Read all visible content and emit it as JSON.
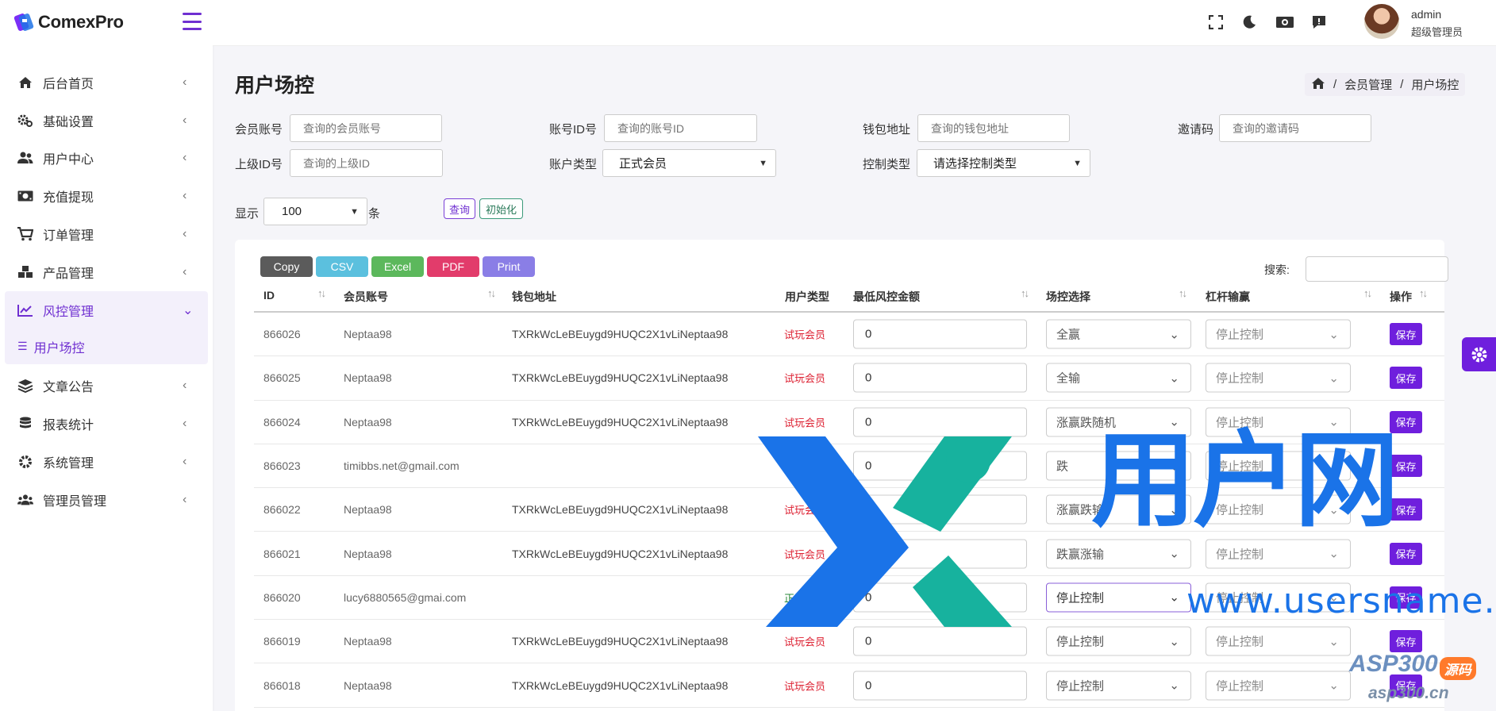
{
  "brand": {
    "name": "ComexPro"
  },
  "sidebar": {
    "items": [
      {
        "label": "后台首页",
        "icon": "home-icon"
      },
      {
        "label": "基础设置",
        "icon": "gears-icon"
      },
      {
        "label": "用户中心",
        "icon": "users-icon"
      },
      {
        "label": "充值提现",
        "icon": "money-icon"
      },
      {
        "label": "订单管理",
        "icon": "cart-icon"
      },
      {
        "label": "产品管理",
        "icon": "cubes-icon"
      },
      {
        "label": "风控管理",
        "icon": "chart-line-icon",
        "active": true
      },
      {
        "label": "文章公告",
        "icon": "layers-icon"
      },
      {
        "label": "报表统计",
        "icon": "database-icon"
      },
      {
        "label": "系统管理",
        "icon": "gear-icon"
      },
      {
        "label": "管理员管理",
        "icon": "user-group-icon"
      }
    ],
    "sub_active": {
      "label": "用户场控"
    }
  },
  "topbar": {
    "user_name": "admin",
    "user_role": "超级管理员"
  },
  "page": {
    "title": "用户场控"
  },
  "breadcrumb": {
    "items": [
      "会员管理",
      "用户场控"
    ]
  },
  "filters": {
    "member_account": {
      "label": "会员账号",
      "placeholder": "查询的会员账号"
    },
    "account_id": {
      "label": "账号ID号",
      "placeholder": "查询的账号ID"
    },
    "wallet": {
      "label": "钱包地址",
      "placeholder": "查询的钱包地址"
    },
    "invite": {
      "label": "邀请码",
      "placeholder": "查询的邀请码"
    },
    "parent_id": {
      "label": "上级ID号",
      "placeholder": "查询的上级ID"
    },
    "account_type": {
      "label": "账户类型",
      "value": "正式会员"
    },
    "control_type": {
      "label": "控制类型",
      "value": "请选择控制类型"
    },
    "show": {
      "label": "显示",
      "value": "100",
      "suffix": "条"
    },
    "query_btn": "查询",
    "reset_btn": "初始化"
  },
  "export": {
    "copy": "Copy",
    "csv": "CSV",
    "excel": "Excel",
    "pdf": "PDF",
    "print": "Print",
    "search_label": "搜索:"
  },
  "table": {
    "headers": [
      "ID",
      "会员账号",
      "钱包地址",
      "用户类型",
      "最低风控金额",
      "场控选择",
      "杠杆输赢",
      "操作"
    ],
    "rows": [
      {
        "id": "866026",
        "account": "Neptaa98",
        "wallet": "TXRkWcLeBEuygd9HUQC2X1vLiNeptaa98",
        "type": "试玩会员",
        "min": "0",
        "field": "全赢",
        "leverage": "停止控制",
        "action": "保存"
      },
      {
        "id": "866025",
        "account": "Neptaa98",
        "wallet": "TXRkWcLeBEuygd9HUQC2X1vLiNeptaa98",
        "type": "试玩会员",
        "min": "0",
        "field": "全输",
        "leverage": "停止控制",
        "action": "保存"
      },
      {
        "id": "866024",
        "account": "Neptaa98",
        "wallet": "TXRkWcLeBEuygd9HUQC2X1vLiNeptaa98",
        "type": "试玩会员",
        "min": "0",
        "field": "涨赢跌随机",
        "leverage": "停止控制",
        "action": "保存"
      },
      {
        "id": "866023",
        "account": "timibbs.net@gmail.com",
        "wallet": "",
        "type": "正式会员",
        "min": "0",
        "field": "跌",
        "leverage": "停止控制",
        "action": "保存"
      },
      {
        "id": "866022",
        "account": "Neptaa98",
        "wallet": "TXRkWcLeBEuygd9HUQC2X1vLiNeptaa98",
        "type": "试玩会员",
        "min": "0",
        "field": "涨赢跌输",
        "leverage": "停止控制",
        "action": "保存"
      },
      {
        "id": "866021",
        "account": "Neptaa98",
        "wallet": "TXRkWcLeBEuygd9HUQC2X1vLiNeptaa98",
        "type": "试玩会员",
        "min": "0",
        "field": "跌赢涨输",
        "leverage": "停止控制",
        "action": "保存"
      },
      {
        "id": "866020",
        "account": "lucy6880565@gmai.com",
        "wallet": "",
        "type": "正式会员",
        "min": "0",
        "field": "停止控制",
        "leverage": "停止控制",
        "action": "保存"
      },
      {
        "id": "866019",
        "account": "Neptaa98",
        "wallet": "TXRkWcLeBEuygd9HUQC2X1vLiNeptaa98",
        "type": "试玩会员",
        "min": "0",
        "field": "停止控制",
        "leverage": "停止控制",
        "action": "保存"
      },
      {
        "id": "866018",
        "account": "Neptaa98",
        "wallet": "TXRkWcLeBEuygd9HUQC2X1vLiNeptaa98",
        "type": "试玩会员",
        "min": "0",
        "field": "停止控制",
        "leverage": "停止控制",
        "action": "保存"
      }
    ]
  },
  "watermark": {
    "title": "用户网",
    "url": "www.usersname.cn",
    "asp": "ASP300",
    "asp_tag": "源码",
    "asp_url": "asp300.cn"
  },
  "colors": {
    "accent": "#6f1fdd",
    "trial": "#dd2233",
    "formal": "#2a8a3a"
  }
}
